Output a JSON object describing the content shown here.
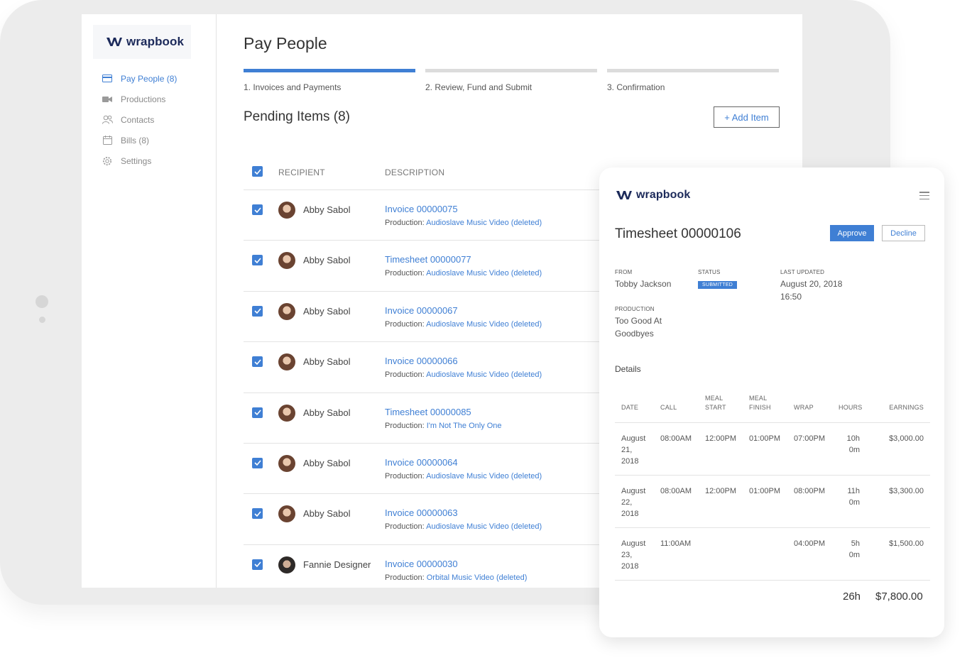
{
  "brand": {
    "name": "wrapbook",
    "color": "#1c2a5a",
    "accent": "#3f7fd4"
  },
  "sidebar": {
    "items": [
      {
        "label": "Pay People (8)",
        "icon": "credit-card-icon",
        "active": true
      },
      {
        "label": "Productions",
        "icon": "video-camera-icon",
        "active": false
      },
      {
        "label": "Contacts",
        "icon": "people-icon",
        "active": false
      },
      {
        "label": "Bills (8)",
        "icon": "calendar-icon",
        "active": false
      },
      {
        "label": "Settings",
        "icon": "gear-icon",
        "active": false
      }
    ]
  },
  "main": {
    "title": "Pay People",
    "steps": [
      {
        "label": "1. Invoices and Payments",
        "active": true
      },
      {
        "label": "2. Review, Fund and Submit",
        "active": false
      },
      {
        "label": "3. Confirmation",
        "active": false
      }
    ],
    "pending_title": "Pending Items (8)",
    "add_item": "+ Add Item",
    "table": {
      "headers": {
        "recipient": "RECIPIENT",
        "description": "DESCRIPTION"
      },
      "rows": [
        {
          "name": "Abby Sabol",
          "desc": "Invoice 00000075",
          "prod_label": "Production:",
          "prod": "Audioslave Music Video (deleted)"
        },
        {
          "name": "Abby Sabol",
          "desc": "Timesheet 00000077",
          "prod_label": "Production:",
          "prod": "Audioslave Music Video (deleted)"
        },
        {
          "name": "Abby Sabol",
          "desc": "Invoice 00000067",
          "prod_label": "Production:",
          "prod": "Audioslave Music Video (deleted)"
        },
        {
          "name": "Abby Sabol",
          "desc": "Invoice 00000066",
          "prod_label": "Production:",
          "prod": "Audioslave Music Video (deleted)"
        },
        {
          "name": "Abby Sabol",
          "desc": "Timesheet 00000085",
          "prod_label": "Production:",
          "prod": "I'm Not The Only One"
        },
        {
          "name": "Abby Sabol",
          "desc": "Invoice 00000064",
          "prod_label": "Production:",
          "prod": "Audioslave Music Video (deleted)"
        },
        {
          "name": "Abby Sabol",
          "desc": "Invoice 00000063",
          "prod_label": "Production:",
          "prod": "Audioslave Music Video (deleted)"
        },
        {
          "name": "Fannie Designer",
          "desc": "Invoice 00000030",
          "prod_label": "Production:",
          "prod": "Orbital Music Video (deleted)"
        }
      ]
    }
  },
  "timesheet": {
    "logo": "wrapbook",
    "title": "Timesheet 00000106",
    "approve": "Approve",
    "decline": "Decline",
    "from_label": "FROM",
    "from": "Tobby Jackson",
    "status_label": "STATUS",
    "status": "SUBMITTED",
    "updated_label": "LAST UPDATED",
    "updated_date": "August 20, 2018",
    "updated_time": "16:50",
    "production_label": "PRODUCTION",
    "production_line1": "Too Good At",
    "production_line2": "Goodbyes",
    "details": "Details",
    "columns": {
      "date": "DATE",
      "call": "CALL",
      "meal_start_1": "MEAL",
      "meal_start_2": "START",
      "meal_finish_1": "MEAL",
      "meal_finish_2": "FINISH",
      "wrap": "WRAP",
      "hours": "HOURS",
      "earnings": "EARNINGS"
    },
    "rows": [
      {
        "d1": "August",
        "d2": "21,",
        "d3": "2018",
        "call": "08:00AM",
        "ms": "12:00PM",
        "mf": "01:00PM",
        "wrap": "07:00PM",
        "h1": "10h",
        "h2": "0m",
        "earn": "$3,000.00"
      },
      {
        "d1": "August",
        "d2": "22,",
        "d3": "2018",
        "call": "08:00AM",
        "ms": "12:00PM",
        "mf": "01:00PM",
        "wrap": "08:00PM",
        "h1": "11h",
        "h2": "0m",
        "earn": "$3,300.00"
      },
      {
        "d1": "August",
        "d2": "23,",
        "d3": "2018",
        "call": "11:00AM",
        "ms": "",
        "mf": "",
        "wrap": "04:00PM",
        "h1": "5h 0m",
        "h2": "",
        "earn": "$1,500.00"
      }
    ],
    "total_hours": "26h",
    "total_earnings": "$7,800.00"
  }
}
